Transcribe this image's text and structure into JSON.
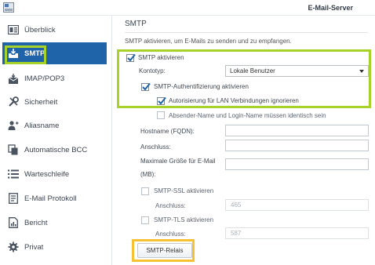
{
  "window": {
    "title": "E-Mail-Server",
    "icon": "app-icon"
  },
  "sidebar": {
    "items": [
      {
        "label": "Überblick",
        "icon": "overview-icon",
        "active": false
      },
      {
        "label": "SMTP",
        "icon": "mail-tray-icon",
        "active": true
      },
      {
        "label": "IMAP/POP3",
        "icon": "envelope-download-icon",
        "active": false
      },
      {
        "label": "Sicherheit",
        "icon": "tools-icon",
        "active": false
      },
      {
        "label": "Aliasname",
        "icon": "user-alias-icon",
        "active": false
      },
      {
        "label": "Automatische BCC",
        "icon": "copy-icon",
        "active": false
      },
      {
        "label": "Warteschleife",
        "icon": "list-icon",
        "active": false
      },
      {
        "label": "E-Mail Protokoll",
        "icon": "log-icon",
        "active": false
      },
      {
        "label": "Bericht",
        "icon": "report-icon",
        "active": false
      },
      {
        "label": "Privat",
        "icon": "gear-icon",
        "active": false
      }
    ]
  },
  "main": {
    "title": "SMTP",
    "description": "SMTP aktivieren, um E-Mails zu senden und zu empfangen.",
    "enable_smtp": {
      "label": "SMTP aktivieren",
      "checked": true
    },
    "account_type": {
      "label": "Kontotyp:",
      "value": "Lokale Benutzer"
    },
    "smtp_auth": {
      "label": "SMTP-Authentifizierung aktivieren",
      "checked": true
    },
    "lan_auth_ignore": {
      "label": "Autorisierung für LAN Verbindungen ignorieren",
      "checked": true
    },
    "sender_login_match": {
      "label": "Absender-Name und Login-Name müssen identisch sein",
      "checked": false
    },
    "hostname": {
      "label": "Hostname (FQDN):",
      "value": ""
    },
    "port": {
      "label": "Anschluss:",
      "value": ""
    },
    "max_size": {
      "label_line1": "Maximale Größe für E-Mail",
      "label_line2": "(MB):",
      "value": ""
    },
    "smtp_ssl": {
      "label": "SMTP-SSL aktivieren",
      "checked": false,
      "port_label": "Anschluss:",
      "port_value": "465"
    },
    "smtp_tls": {
      "label": "SMTP-TLS aktivieren",
      "checked": false,
      "port_label": "Anschluss:",
      "port_value": "587"
    },
    "relay_button": "SMTP-Relais"
  },
  "colors": {
    "accent": "#1f63a8",
    "highlight_green": "#a6d22a",
    "highlight_orange": "#f6c233"
  }
}
